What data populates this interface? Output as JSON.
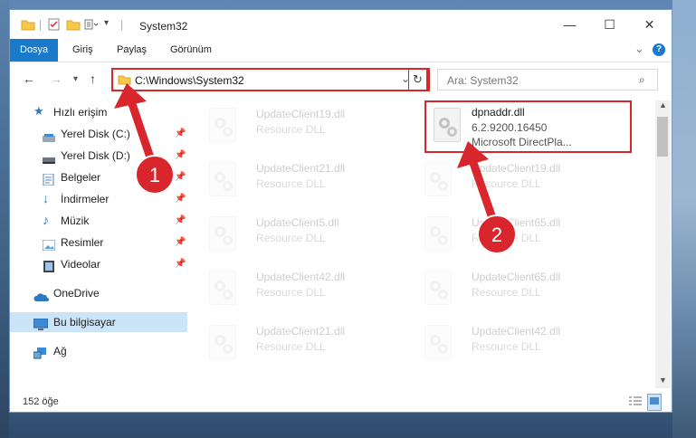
{
  "window": {
    "title": "System32",
    "minimize_glyph": "—",
    "maximize_glyph": "☐",
    "close_glyph": "✕"
  },
  "ribbon": {
    "tabs": [
      "Dosya",
      "Giriş",
      "Paylaş",
      "Görünüm"
    ],
    "active_tab": "Dosya",
    "expand_glyph": "⌄",
    "help_glyph": "?"
  },
  "address": {
    "path": "C:\\Windows\\System32",
    "search_placeholder": "Ara: System32"
  },
  "sidebar": {
    "items": [
      {
        "label": "Hızlı erişim",
        "icon": "star-icon",
        "pinned": false
      },
      {
        "label": "Yerel Disk (C:)",
        "icon": "drive-icon",
        "pinned": true
      },
      {
        "label": "Yerel Disk (D:)",
        "icon": "drive-icon",
        "pinned": true
      },
      {
        "label": "Belgeler",
        "icon": "documents-icon",
        "pinned": true
      },
      {
        "label": "İndirmeler",
        "icon": "download-icon",
        "pinned": true
      },
      {
        "label": "Müzik",
        "icon": "music-icon",
        "pinned": true
      },
      {
        "label": "Resimler",
        "icon": "pictures-icon",
        "pinned": true
      },
      {
        "label": "Videolar",
        "icon": "video-icon",
        "pinned": true
      },
      {
        "label": "OneDrive",
        "icon": "onedrive-icon",
        "pinned": false
      },
      {
        "label": "Bu bilgisayar",
        "icon": "computer-icon",
        "pinned": false
      },
      {
        "label": "Ağ",
        "icon": "network-icon",
        "pinned": false
      }
    ],
    "selected": "Bu bilgisayar"
  },
  "files": [
    {
      "name": "UpdateClient19.dll",
      "type": "Resource DLL"
    },
    {
      "name": "dpnaddr.dll",
      "version": "6.2.9200.16450",
      "type": "Microsoft DirectPla...",
      "highlighted": true
    },
    {
      "name": "UpdateClient21.dll",
      "type": "Resource DLL"
    },
    {
      "name": "UpdateClient19.dll",
      "type": "Resource DLL"
    },
    {
      "name": "UpdateClient5.dll",
      "type": "Resource DLL"
    },
    {
      "name": "UpdateClient65.dll",
      "type": "Resource DLL"
    },
    {
      "name": "UpdateClient42.dll",
      "type": "Resource DLL"
    },
    {
      "name": "UpdateClient65.dll",
      "type": "Resource DLL"
    },
    {
      "name": "UpdateClient21.dll",
      "type": "Resource DLL"
    },
    {
      "name": "UpdateClient42.dll",
      "type": "Resource DLL"
    }
  ],
  "status": {
    "item_count": "152 öğe"
  },
  "annotations": {
    "step1": "1",
    "step2": "2",
    "color": "#d9262c"
  }
}
